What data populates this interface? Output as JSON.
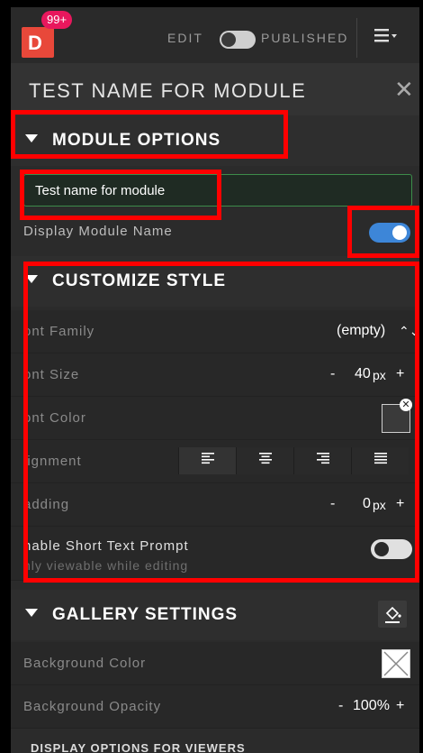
{
  "topbar": {
    "logo_letter": "D",
    "badge": "99+",
    "edit_label": "EDIT",
    "published_label": "PUBLISHED",
    "menu_icon": "hamburger-menu-icon"
  },
  "module_title": "TEST NAME FOR MODULE",
  "close_icon": "close-icon",
  "module_options": {
    "header": "MODULE OPTIONS",
    "name_value": "Test name for module",
    "display_name_label": "Display Module Name",
    "display_name_on": true
  },
  "customize_style": {
    "header": "CUSTOMIZE STYLE",
    "font_family_label": "ont Family",
    "font_family_value": "(empty)",
    "font_family_chevron": "⌃",
    "font_size_label": "ont Size",
    "font_size_minus": "-",
    "font_size_value": "40",
    "font_size_unit": "px",
    "font_size_plus": "+",
    "font_color_label": "ont Color",
    "alignment_label": "lignment",
    "alignment_buttons": [
      "align-left",
      "align-center",
      "align-right",
      "align-justify"
    ],
    "padding_label": "adding",
    "padding_minus": "-",
    "padding_value": "0",
    "padding_unit": "px",
    "padding_plus": "+",
    "short_text_label": "nable Short Text Prompt",
    "short_text_sub": "nly viewable while editing",
    "short_text_on": false
  },
  "gallery_settings": {
    "header": "GALLERY SETTINGS",
    "bg_color_label": "Background Color",
    "bg_opacity_label": "Background Opacity",
    "bg_opacity_minus": "-",
    "bg_opacity_value": "100%",
    "bg_opacity_plus": "+",
    "cut_label": "DISPLAY OPTIONS FOR VIEWERS"
  },
  "colors": {
    "logo": "#e8483a",
    "badge": "#e8175d",
    "toggle_on": "#3d86d8",
    "annotation": "#ff0000",
    "input_border": "#3d8c4a"
  }
}
